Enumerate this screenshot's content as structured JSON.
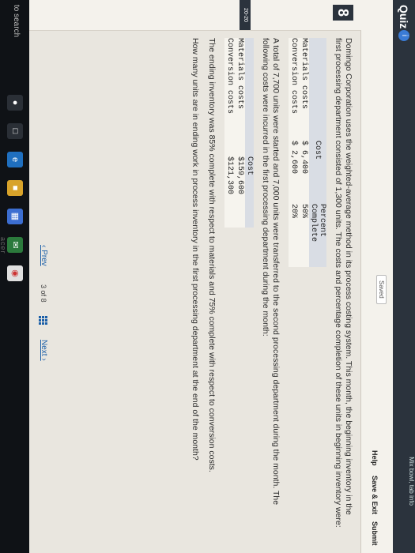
{
  "header": {
    "quiz_title": "Quiz",
    "quiz_badge": "i",
    "tab_hint": "Mix bowl, tab info"
  },
  "toolbar": {
    "saved": "Saved",
    "help": "Help",
    "save_exit": "Save & Exit",
    "submit": "Submit"
  },
  "question": {
    "number": "8",
    "points": "20-20",
    "intro": "Domingo Corporation uses the weighted-average method in its process costing system. This month, the beginning inventory in the first processing department consisted of 1,300 units. The costs and percentage completion of these units in beginning inventory were:",
    "table1": {
      "headers": [
        "",
        "Cost",
        "Percent Complete"
      ],
      "rows": [
        [
          "Materials costs",
          "$ 6,400",
          "50%"
        ],
        [
          "Conversion costs",
          "$ 2,600",
          "20%"
        ]
      ]
    },
    "middle": "A total of 7,700 units were started and 7,000 units were transferred to the second processing department during the month. The following costs were incurred in the first processing department during the month:",
    "table2": {
      "headers": [
        "",
        "Cost"
      ],
      "rows": [
        [
          "Materials costs",
          "$159,600"
        ],
        [
          "Conversion costs",
          "$121,300"
        ]
      ]
    },
    "ending": "The ending inventory was 85% complete with respect to materials and 75% complete with respect to conversion costs.",
    "ask": "How many units are in ending work in process inventory in the first processing department at the end of the month?"
  },
  "nav": {
    "prev": "Prev",
    "page_current": "3",
    "page_of": "of",
    "page_total": "8",
    "next": "Next"
  },
  "taskbar": {
    "search": "to search",
    "brand": "acer"
  }
}
